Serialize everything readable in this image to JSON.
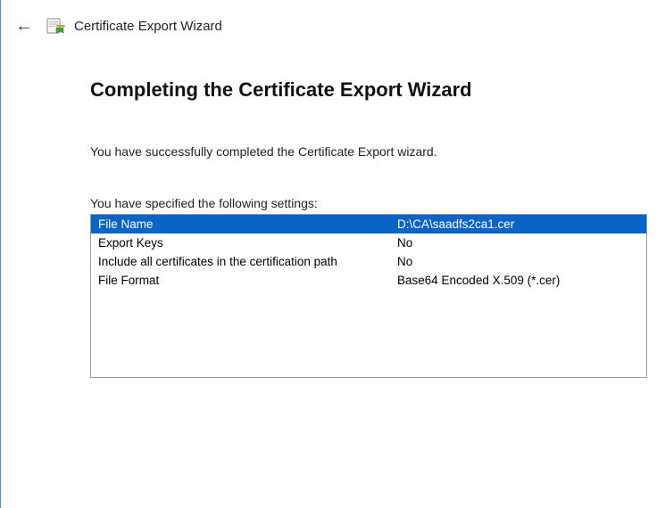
{
  "header": {
    "wizard_title": "Certificate Export Wizard"
  },
  "page": {
    "heading": "Completing the Certificate Export Wizard",
    "intro": "You have successfully completed the Certificate Export wizard.",
    "settings_label": "You have specified the following settings:"
  },
  "settings": {
    "rows": [
      {
        "label": "File Name",
        "value": "D:\\CA\\saadfs2ca1.cer",
        "selected": true
      },
      {
        "label": "Export Keys",
        "value": "No",
        "selected": false
      },
      {
        "label": "Include all certificates in the certification path",
        "value": "No",
        "selected": false
      },
      {
        "label": "File Format",
        "value": "Base64 Encoded X.509 (*.cer)",
        "selected": false
      }
    ]
  }
}
